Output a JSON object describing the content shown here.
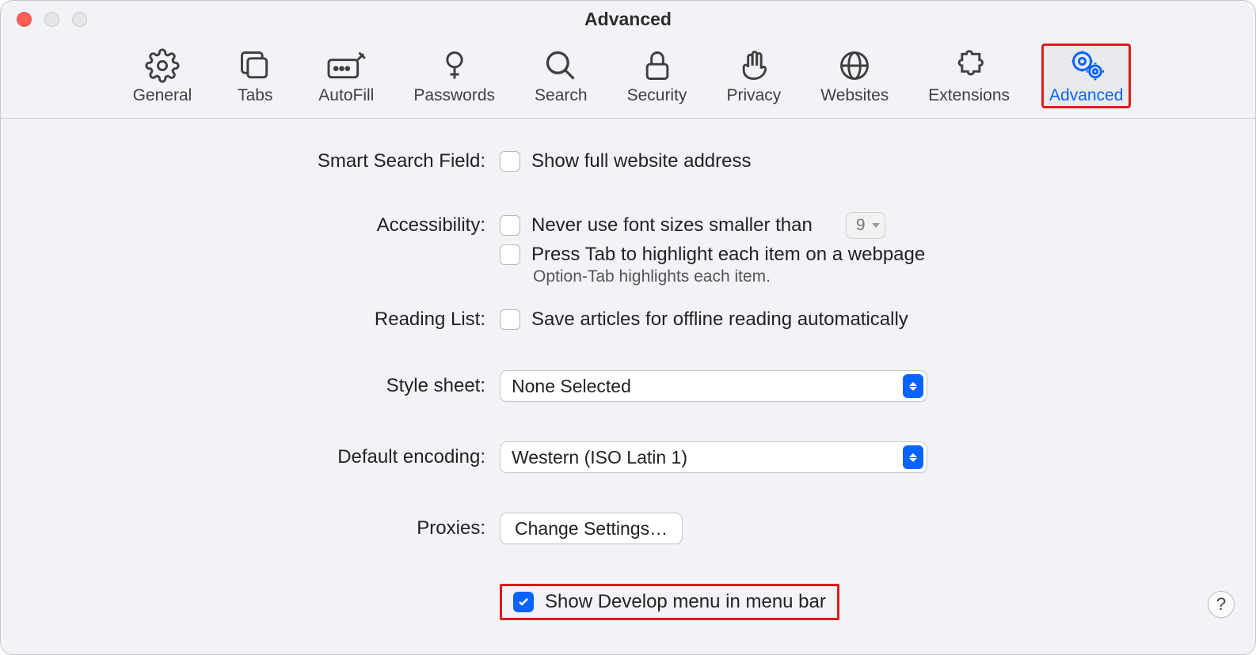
{
  "window": {
    "title": "Advanced"
  },
  "toolbar": {
    "items": [
      {
        "label": "General"
      },
      {
        "label": "Tabs"
      },
      {
        "label": "AutoFill"
      },
      {
        "label": "Passwords"
      },
      {
        "label": "Search"
      },
      {
        "label": "Security"
      },
      {
        "label": "Privacy"
      },
      {
        "label": "Websites"
      },
      {
        "label": "Extensions"
      },
      {
        "label": "Advanced"
      }
    ]
  },
  "sections": {
    "smart_search": {
      "label": "Smart Search Field:",
      "show_full_address": {
        "text": "Show full website address",
        "checked": false
      }
    },
    "accessibility": {
      "label": "Accessibility:",
      "min_font": {
        "text": "Never use font sizes smaller than",
        "checked": false,
        "value": "9"
      },
      "tab_highlight": {
        "text": "Press Tab to highlight each item on a webpage",
        "checked": false
      },
      "hint": "Option-Tab highlights each item."
    },
    "reading_list": {
      "label": "Reading List:",
      "offline": {
        "text": "Save articles for offline reading automatically",
        "checked": false
      }
    },
    "stylesheet": {
      "label": "Style sheet:",
      "value": "None Selected"
    },
    "encoding": {
      "label": "Default encoding:",
      "value": "Western (ISO Latin 1)"
    },
    "proxies": {
      "label": "Proxies:",
      "button": "Change Settings…"
    },
    "develop": {
      "text": "Show Develop menu in menu bar",
      "checked": true
    }
  },
  "help": "?"
}
